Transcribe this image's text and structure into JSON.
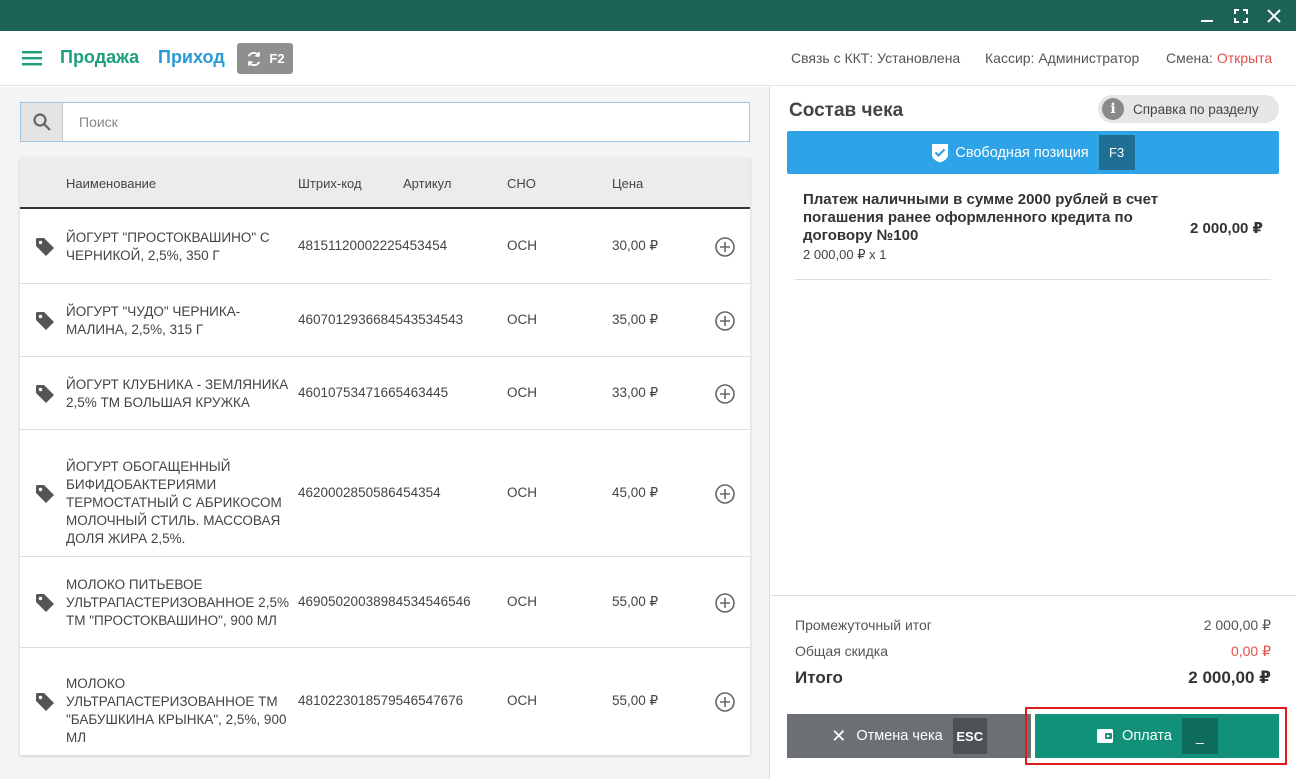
{
  "header": {
    "tab_sale": "Продажа",
    "tab_income": "Приход",
    "switch_key": "F2",
    "kkt_status": "Связь с ККТ: Установлена",
    "cashier": "Кассир: Администратор",
    "shift_label": "Смена:",
    "shift_value": "Открыта"
  },
  "search": {
    "placeholder": "Поиск"
  },
  "table": {
    "columns": [
      "Наименование",
      "Штрих-код",
      "Артикул",
      "СНО",
      "Цена"
    ],
    "rows": [
      {
        "name": "ЙОГУРТ \"ПРОСТОКВАШИНО\" С ЧЕРНИКОЙ, 2,5%, 350 Г",
        "barcode": "4815112000222545345​4",
        "sku": "",
        "sno": "ОСН",
        "price": "30,00 ₽"
      },
      {
        "name": "ЙОГУРТ \"ЧУДО\" ЧЕРНИКА-МАЛИНА, 2,5%, 315 Г",
        "barcode": "460701293668454353454​3",
        "sku": "",
        "sno": "ОСН",
        "price": "35,00 ₽"
      },
      {
        "name": "ЙОГУРТ КЛУБНИКА - ЗЕМЛЯНИКА 2,5% ТМ БОЛЬШАЯ КРУЖКА",
        "barcode": "4601075347166546344​5",
        "sku": "",
        "sno": "ОСН",
        "price": "33,00 ₽"
      },
      {
        "name": "ЙОГУРТ ОБОГАЩЕННЫЙ БИФИДОБАКТЕРИЯМИ ТЕРМОСТАТНЫЙ С АБРИКОСОМ МОЛОЧНЫЙ СТИЛЬ. МАССОВАЯ ДОЛЯ ЖИРА 2,5%.",
        "barcode": "462000285058645435​4",
        "sku": "",
        "sno": "ОСН",
        "price": "45,00 ₽"
      },
      {
        "name": "МОЛОКО ПИТЬЕВОЕ УЛЬТРАПАСТЕРИЗОВАННОЕ 2,5% ТМ \"ПРОСТОКВАШИНО\", 900 МЛ",
        "barcode": "469050200389845345465​46",
        "sku": "",
        "sno": "ОСН",
        "price": "55,00 ₽"
      },
      {
        "name": "МОЛОКО УЛЬТРАПАСТЕРИЗОВАННОЕ ТМ \"БАБУШКИНА КРЫНКА\", 2,5%, 900 МЛ",
        "barcode": "481022301857954654767​6",
        "sku": "",
        "sno": "ОСН",
        "price": "55,00 ₽"
      }
    ]
  },
  "receipt": {
    "title": "Состав чека",
    "help_label": "Справка по разделу",
    "free_position_label": "Свободная позиция",
    "free_position_key": "F3",
    "item": {
      "name": "Платеж наличными в сумме 2000 рублей в счет погашения ранее оформленного кредита по договору №100",
      "qty": "2 000,00 ₽ x 1",
      "sum": "2 000,00 ₽"
    },
    "subtotal_label": "Промежуточный итог",
    "subtotal_value": "2 000,00 ₽",
    "discount_label": "Общая скидка",
    "discount_value": "0,00 ₽",
    "total_label": "Итого",
    "total_value": "2 000,00 ₽",
    "cancel_label": "Отмена чека",
    "cancel_key": "ESC",
    "pay_label": "Оплата",
    "pay_key": "_"
  },
  "colors": {
    "titlebar": "#1c6356",
    "sale": "#1d9e7c",
    "income": "#2a9ad6",
    "free_btn": "#2ea3e8",
    "pay_btn": "#12917a",
    "cancel_btn": "#6c6f73",
    "status_open": "#e0524b",
    "highlight": "#e01b1b"
  }
}
